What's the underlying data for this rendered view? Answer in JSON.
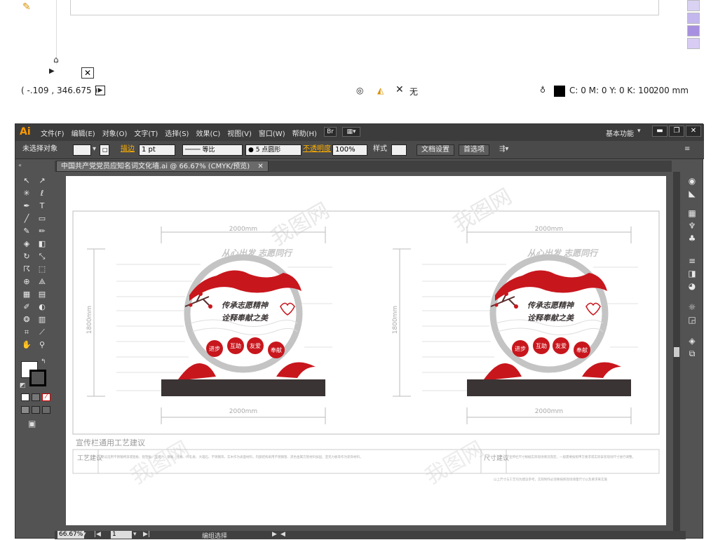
{
  "top": {
    "coords": "( -.109 , 346.675 )",
    "none_label": "无",
    "color_values": "C: 0 M: 0 Y: 0 K: 100",
    "stroke_size": ".200 mm",
    "swatch_colors": [
      "#ffffff",
      "#d9d2f2",
      "#c4b7ee",
      "#a890e0",
      "#d8ccf4"
    ]
  },
  "window": {
    "app_logo": "Ai",
    "menus": [
      "文件(F)",
      "编辑(E)",
      "对象(O)",
      "文字(T)",
      "选择(S)",
      "效果(C)",
      "视图(V)",
      "窗口(W)",
      "帮助(H)"
    ],
    "bridge": "Br",
    "workspace": "基本功能",
    "controls": [
      "▬",
      "❐",
      "✕"
    ]
  },
  "controlbar": {
    "selection": "未选择对象",
    "stroke_label": "描边",
    "stroke_value": "1 pt",
    "ratio_label": "等比",
    "brush_label": "5 点圆形",
    "opacity_label": "不透明度",
    "opacity_value": "100%",
    "style_label": "样式",
    "doc_setup": "文档设置",
    "prefs": "首选项"
  },
  "tab": {
    "title": "中国共产党党员应知名词文化墙.ai @ 66.67% (CMYK/预览)",
    "close": "✕"
  },
  "artwork": {
    "dim_width": "2000mm",
    "dim_height": "1800mm",
    "banner_top": "从心出发 志愿同行",
    "slogan1": "传承志愿精神",
    "slogan2": "诠释奉献之美",
    "badges": [
      "进步",
      "互助",
      "友爱",
      "奉献"
    ],
    "section_title": "宣传栏通用工艺建议",
    "craft_label": "工艺建议",
    "size_label": "尺寸建议",
    "craft_text": "建议选用不锈钢烤漆或铝板、铝塑板、亚克力、钢板、铝板、冷轧板、大理石、不锈钢等，实木作为表面材料，内部结构采用不锈钢管、黑色金属方管材料加固，亚克力板等作为装饰材料。",
    "size_text": "宣传栏尺寸根据实际现场情况而定，一般需要按照甲方要求或实际安装现场尺寸进行调整。",
    "note_text": "以上尺寸与工艺均为建议参考，实际制作必须要按照现场测量尺寸以及要求来实施",
    "watermark": "我图网"
  },
  "statusbar": {
    "zoom": "66.67%",
    "page": "1",
    "mode": "编组选择"
  },
  "colors": {
    "red": "#c8161d",
    "dark": "#3b3434",
    "gray": "#bdbdbd"
  }
}
